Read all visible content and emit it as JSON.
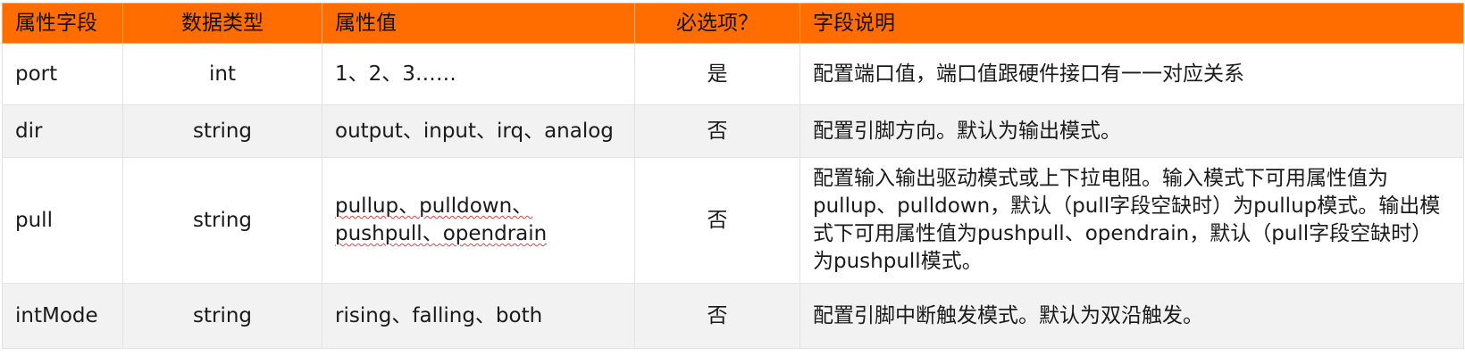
{
  "headers": {
    "field": "属性字段",
    "type": "数据类型",
    "value": "属性值",
    "required": "必选项？",
    "desc": "字段说明"
  },
  "rows": [
    {
      "field": "port",
      "type": "int",
      "value": "1、2、3……",
      "required": "是",
      "desc": "配置端口值，端口值跟硬件接口有一一对应关系"
    },
    {
      "field": "dir",
      "type": "string",
      "value": "output、input、irq、analog",
      "required": "否",
      "desc": "配置引脚方向。默认为输出模式。"
    },
    {
      "field": "pull",
      "type": "string",
      "value": "pullup、pulldown、pushpull、opendrain",
      "required": "否",
      "desc": "配置输入输出驱动模式或上下拉电阻。输入模式下可用属性值为pullup、pulldown，默认（pull字段空缺时）为pullup模式。输出模式下可用属性值为pushpull、opendrain，默认（pull字段空缺时）为pushpull模式。"
    },
    {
      "field": "intMode",
      "type": "string",
      "value": "rising、falling、both",
      "required": "否",
      "desc": "配置引脚中断触发模式。默认为双沿触发。"
    }
  ]
}
